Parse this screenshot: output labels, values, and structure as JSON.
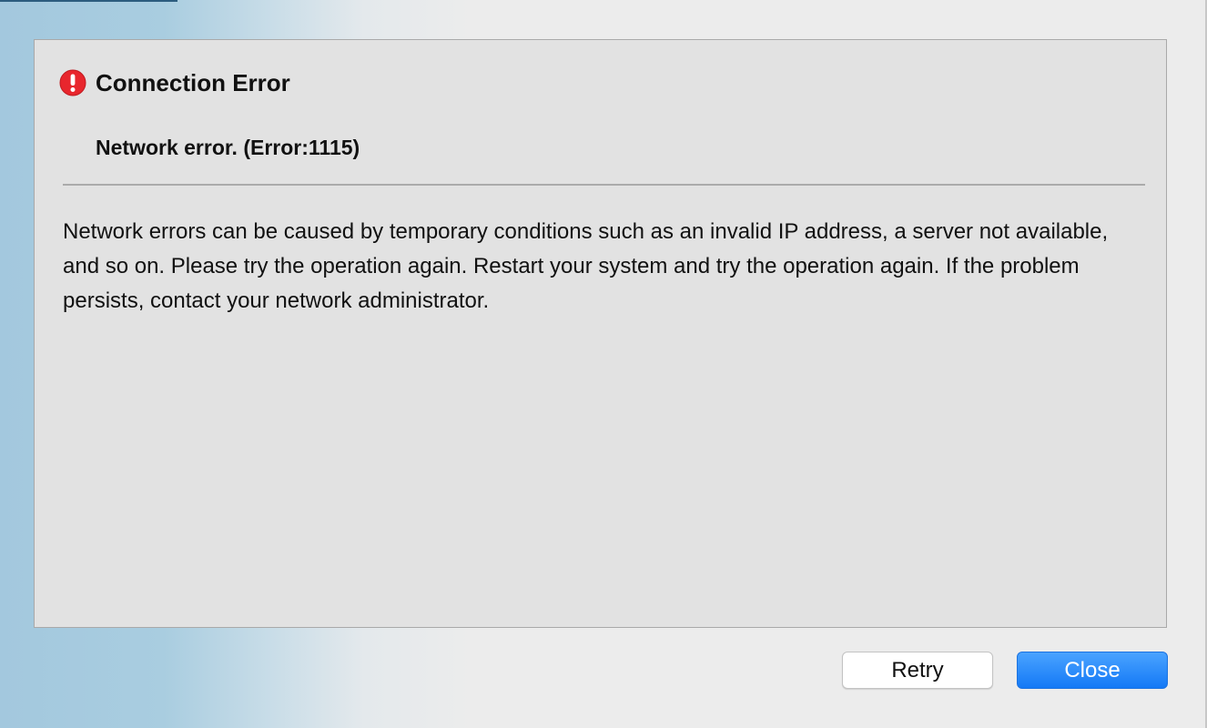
{
  "dialog": {
    "title": "Connection Error",
    "subtitle": "Network error. (Error:1115)",
    "message": "Network errors can be caused by temporary conditions such as an invalid IP address, a server not available, and so on. Please try the operation again. Restart your system and try the operation again. If the problem persists, contact your network administrator.",
    "icon": "error-exclamation-icon"
  },
  "buttons": {
    "retry_label": "Retry",
    "close_label": "Close"
  },
  "colors": {
    "error_icon": "#e8262d",
    "primary_button": "#1479f6",
    "panel_background": "#e2e2e2"
  }
}
